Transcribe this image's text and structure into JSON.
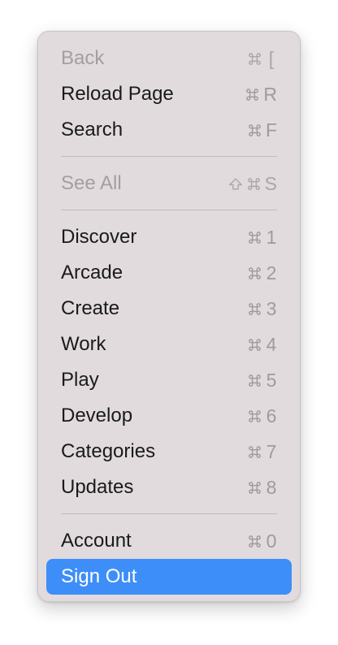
{
  "menu": {
    "items": [
      {
        "label": "Back",
        "shortcut_key": "[",
        "disabled": true
      },
      {
        "label": "Reload Page",
        "shortcut_key": "R"
      },
      {
        "label": "Search",
        "shortcut_key": "F"
      },
      {
        "label": "See All",
        "shortcut_key": "S",
        "shift": true,
        "disabled": true
      },
      {
        "label": "Discover",
        "shortcut_key": "1"
      },
      {
        "label": "Arcade",
        "shortcut_key": "2"
      },
      {
        "label": "Create",
        "shortcut_key": "3"
      },
      {
        "label": "Work",
        "shortcut_key": "4"
      },
      {
        "label": "Play",
        "shortcut_key": "5"
      },
      {
        "label": "Develop",
        "shortcut_key": "6"
      },
      {
        "label": "Categories",
        "shortcut_key": "7"
      },
      {
        "label": "Updates",
        "shortcut_key": "8"
      },
      {
        "label": "Account",
        "shortcut_key": "0"
      },
      {
        "label": "Sign Out",
        "selected": true
      }
    ]
  },
  "icons": {
    "command": "command-key-icon",
    "shift": "shift-key-icon"
  },
  "colors": {
    "menu_background": "#e1dbde",
    "selection": "#3d8ef8",
    "disabled_text": "#a29ea1"
  }
}
